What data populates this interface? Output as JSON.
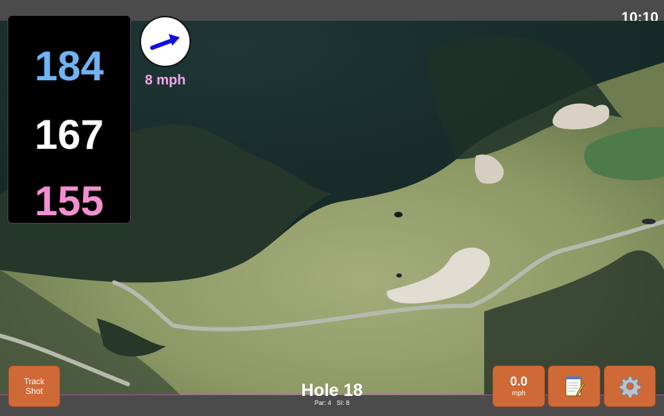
{
  "status_bar": {
    "time": "10:10"
  },
  "distances": {
    "back": "184",
    "middle": "167",
    "front": "155"
  },
  "wind": {
    "speed": "8 mph",
    "direction_icon": "wind-arrow-icon"
  },
  "buttons": {
    "track_shot": "Track\nShot",
    "speed_value": "0.0",
    "speed_unit": "mph",
    "notes_icon": "notepad-icon",
    "settings_icon": "gear-icon"
  },
  "hole": {
    "title": "Hole 18",
    "par": "Par: 4",
    "si": "SI: 8"
  },
  "colors": {
    "back_distance": "#6fb3f2",
    "middle_distance": "#ffffff",
    "front_distance": "#f38fd0",
    "button": "#cf6a37",
    "wind_speed": "#f4a6ea"
  }
}
